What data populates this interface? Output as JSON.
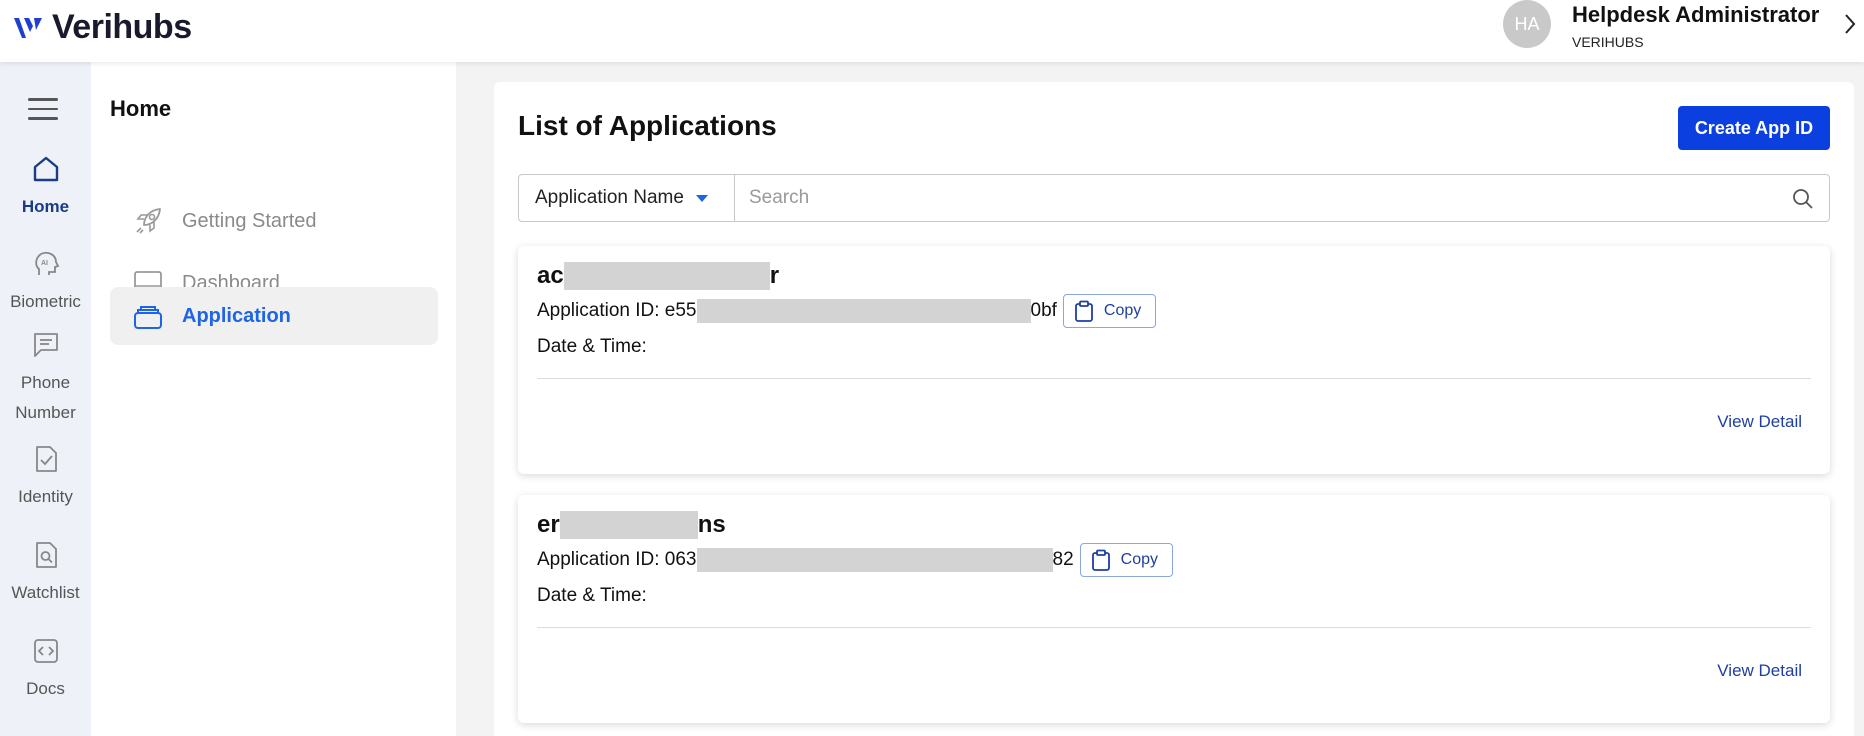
{
  "header": {
    "brand": "Verihubs",
    "avatar_initials": "HA",
    "user_name": "Helpdesk Administrator",
    "user_org": "VERIHUBS"
  },
  "rail": {
    "items": [
      {
        "label": "Home",
        "icon": "home-icon",
        "active": true
      },
      {
        "label": "Biometric",
        "icon": "ai-head-icon"
      },
      {
        "label": "Phone",
        "label2": "Number",
        "icon": "chat-icon"
      },
      {
        "label": "Identity",
        "icon": "document-check-icon"
      },
      {
        "label": "Watchlist",
        "icon": "document-search-icon"
      },
      {
        "label": "Docs",
        "icon": "code-icon"
      }
    ]
  },
  "subnav": {
    "title": "Home",
    "items": [
      {
        "label": "Getting Started",
        "icon": "rocket-icon"
      },
      {
        "label": "Dashboard",
        "icon": "monitor-icon"
      },
      {
        "label": "Application",
        "icon": "stack-icon",
        "active": true
      }
    ]
  },
  "main": {
    "title": "List of Applications",
    "create_label": "Create App ID",
    "filter_value": "Application Name",
    "search_placeholder": "Search",
    "id_label": "Application ID:",
    "date_label": "Date & Time:",
    "copy_label": "Copy",
    "view_detail_label": "View Detail",
    "applications": [
      {
        "name_start": "ac",
        "name_end": "r",
        "id_start": "e55",
        "id_end": "0bf",
        "date": ""
      },
      {
        "name_start": "er",
        "name_end": "ns",
        "id_start": "063",
        "id_end": "82",
        "date": ""
      }
    ]
  },
  "colors": {
    "accent": "#0b3fe0",
    "active_link": "#1e64e6",
    "rail_bg": "#eef2f8",
    "rail_active": "#1b3b86"
  }
}
